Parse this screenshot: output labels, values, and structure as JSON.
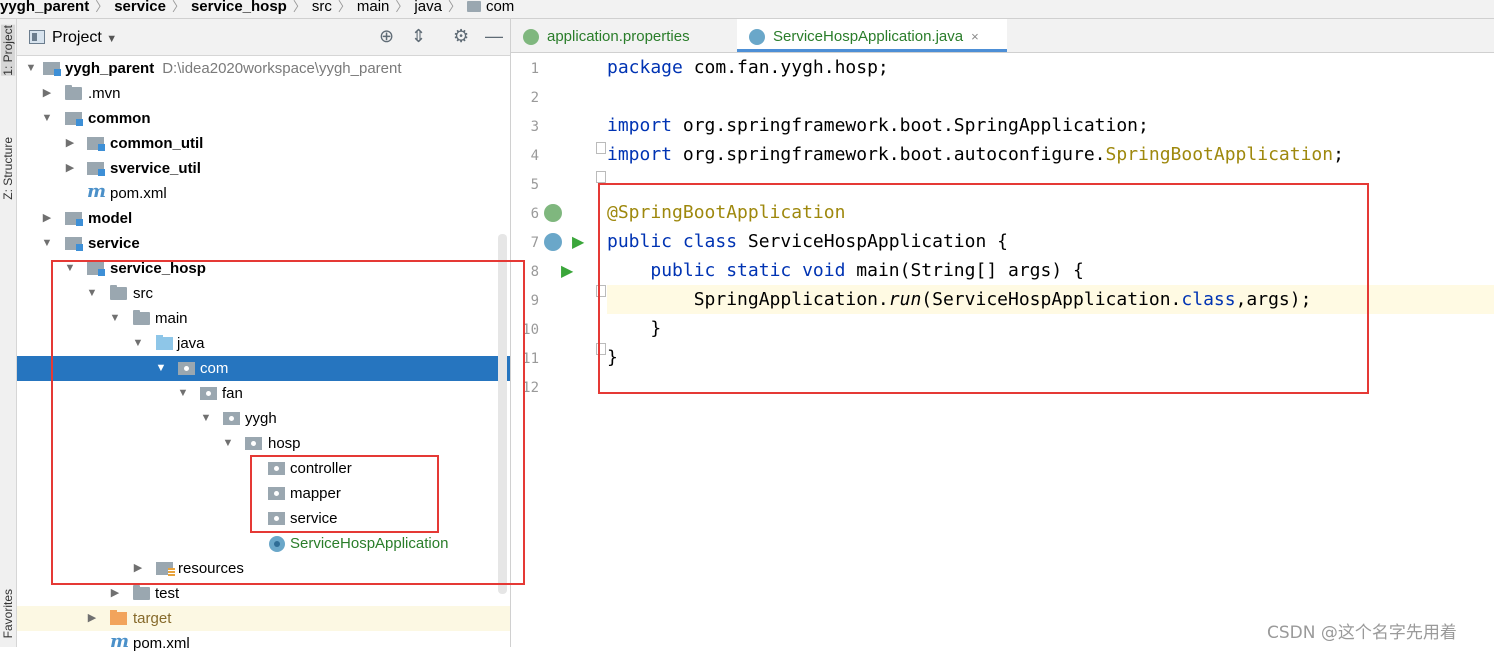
{
  "breadcrumb": [
    {
      "label": "yygh_parent",
      "bold": true
    },
    {
      "label": "service",
      "bold": true
    },
    {
      "label": "service_hosp",
      "bold": true
    },
    {
      "label": "src",
      "bold": false
    },
    {
      "label": "main",
      "bold": false
    },
    {
      "label": "java",
      "bold": false
    },
    {
      "label": "com",
      "bold": false,
      "icon": "package-folder-icon"
    }
  ],
  "side_tabs": {
    "project": "1: Project",
    "structure": "Z: Structure",
    "favorites": "Favorites"
  },
  "project_panel": {
    "title": "Project",
    "header_icons": [
      "locate-icon",
      "collapse-icon",
      "gear-icon",
      "minimize-icon"
    ]
  },
  "tree": [
    {
      "label": "yygh_parent",
      "path": "D:\\idea2020workspace\\yygh_parent",
      "bold": true,
      "icon": "module",
      "expanded": true
    },
    {
      "label": ".mvn",
      "icon": "folder",
      "expanded": false
    },
    {
      "label": "common",
      "bold": true,
      "icon": "module",
      "expanded": true
    },
    {
      "label": "common_util",
      "bold": true,
      "icon": "module",
      "expanded": false
    },
    {
      "label": "svervice_util",
      "bold": true,
      "icon": "module",
      "expanded": false
    },
    {
      "label": "pom.xml",
      "icon": "maven"
    },
    {
      "label": "model",
      "bold": true,
      "icon": "module",
      "expanded": false
    },
    {
      "label": "service",
      "bold": true,
      "icon": "module",
      "expanded": true
    },
    {
      "label": "service_hosp",
      "bold": true,
      "icon": "module",
      "expanded": true
    },
    {
      "label": "src",
      "icon": "folder",
      "expanded": true
    },
    {
      "label": "main",
      "icon": "folder",
      "expanded": true
    },
    {
      "label": "java",
      "icon": "source-folder",
      "expanded": true
    },
    {
      "label": "com",
      "icon": "package",
      "expanded": true,
      "selected": true
    },
    {
      "label": "fan",
      "icon": "package",
      "expanded": true
    },
    {
      "label": "yygh",
      "icon": "package",
      "expanded": true
    },
    {
      "label": "hosp",
      "icon": "package",
      "expanded": true
    },
    {
      "label": "controller",
      "icon": "package"
    },
    {
      "label": "mapper",
      "icon": "package"
    },
    {
      "label": "service",
      "icon": "package"
    },
    {
      "label": "ServiceHospApplication",
      "icon": "spring-class",
      "green": true
    },
    {
      "label": "resources",
      "icon": "resources-folder",
      "expanded": false
    },
    {
      "label": "test",
      "icon": "folder",
      "expanded": false
    },
    {
      "label": "target",
      "icon": "excluded-folder",
      "expanded": false
    },
    {
      "label": "pom.xml",
      "icon": "maven"
    }
  ],
  "editor": {
    "tabs": [
      {
        "label": "application.properties",
        "active": false,
        "icon": "spring-properties-icon"
      },
      {
        "label": "ServiceHospApplication.java",
        "active": true,
        "icon": "spring-class-icon",
        "close": "×"
      }
    ],
    "line_numbers": [
      "1",
      "2",
      "3",
      "4",
      "5",
      "6",
      "7",
      "8",
      "9",
      "10",
      "11",
      "12"
    ],
    "code": {
      "l1_kw": "package",
      "l1_rest": " com.fan.yygh.hosp;",
      "l3_kw": "import",
      "l3_rest": " org.springframework.boot.SpringApplication;",
      "l4_kw": "import",
      "l4_rest": " org.springframework.boot.autoconfigure.",
      "l4_ann": "SpringBootApplication",
      "l4_end": ";",
      "l6_ann": "@SpringBootApplication",
      "l7_kw": "public class",
      "l7_rest": " ServiceHospApplication {",
      "l8_indent": "    ",
      "l8_kw": "public static void",
      "l8_rest": " main(String[] args) {",
      "l9_indent": "        ",
      "l9_a": "SpringApplication.",
      "l9_run": "run",
      "l9_b": "(ServiceHospApplication.",
      "l9_kw": "class",
      "l9_c": ",args);",
      "l10": "    }",
      "l11": "}"
    }
  },
  "watermark": "CSDN @这个名字先用着"
}
